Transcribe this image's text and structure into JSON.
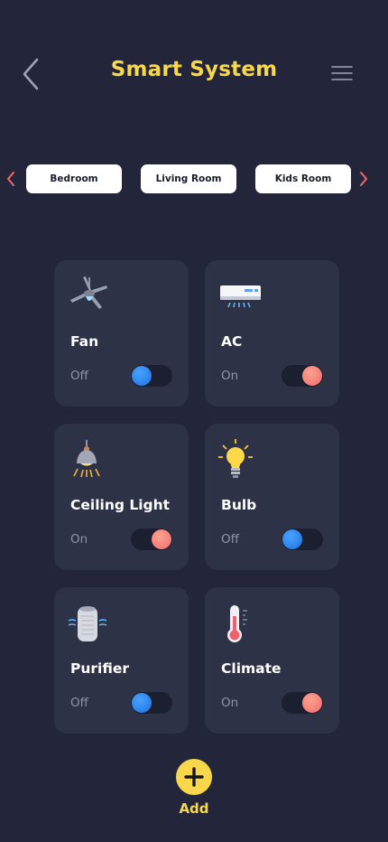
{
  "header": {
    "title": "Smart System",
    "back_icon": "chevron-left-icon",
    "menu_icon": "hamburger-menu-icon"
  },
  "rooms": {
    "tabs": [
      "Bedroom",
      "Living Room",
      "Kids Room"
    ],
    "prev_icon": "chevron-left-icon",
    "next_icon": "chevron-right-icon"
  },
  "devices": [
    {
      "name": "Fan",
      "status": "Off",
      "on": false,
      "icon": "ceiling-fan-icon"
    },
    {
      "name": "AC",
      "status": "On",
      "on": true,
      "icon": "air-conditioner-icon"
    },
    {
      "name": "Ceiling Light",
      "status": "On",
      "on": true,
      "icon": "ceiling-lamp-icon"
    },
    {
      "name": "Bulb",
      "status": "Off",
      "on": false,
      "icon": "light-bulb-icon"
    },
    {
      "name": "Purifier",
      "status": "Off",
      "on": false,
      "icon": "air-purifier-icon"
    },
    {
      "name": "Climate",
      "status": "On",
      "on": true,
      "icon": "thermometer-icon"
    }
  ],
  "add": {
    "label": "Add",
    "icon": "plus-icon"
  },
  "colors": {
    "background": "#23263a",
    "card": "#2e3246",
    "accent": "#f8d84a",
    "nav_arrow": "#f06767",
    "toggle_off": "#2f8ef5",
    "toggle_on": "#f58a80",
    "status_text": "#8f93a8"
  }
}
